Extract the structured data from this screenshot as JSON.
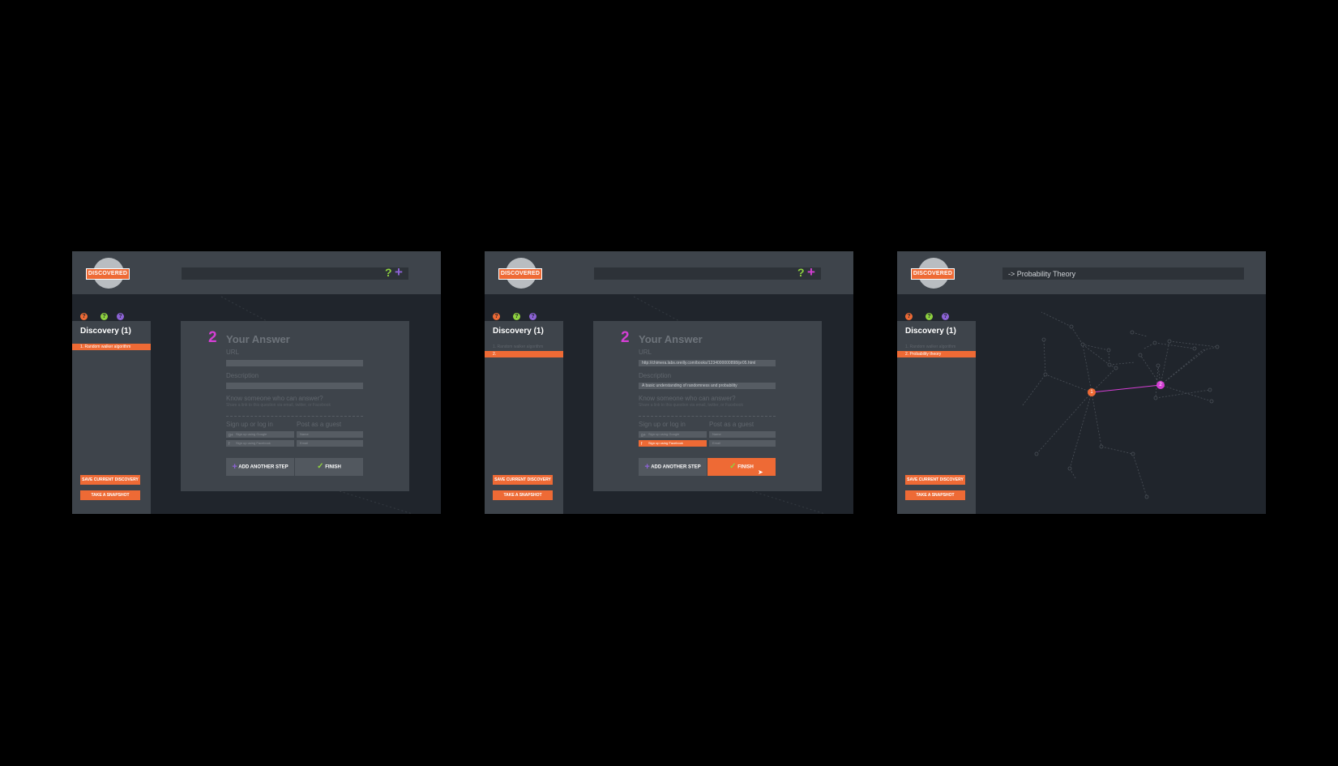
{
  "colors": {
    "background": "#000000",
    "canvas": "#20252c",
    "chrome": "#3e444b",
    "accent": "#ee6a35",
    "help_green": "#8ed13f",
    "add_purple": "#8d63d6",
    "step_magenta": "#d43fd4",
    "tab_orange": "#ee6a35",
    "tab_green": "#8ed13f",
    "tab_purple": "#8d63d6"
  },
  "icons": {
    "logo": "discovered-badge",
    "help": "question-mark-icon",
    "add": "plus-icon",
    "google": "google-icon",
    "facebook": "facebook-icon",
    "check": "check-icon",
    "cursor": "mouse-pointer-icon"
  },
  "screens": [
    {
      "logo_text": "DISCOVERED",
      "search": {
        "help": "?",
        "add": "+",
        "breadcrumb": ""
      },
      "tabs": [
        "?",
        "?",
        "?"
      ],
      "sidebar": {
        "title": "Discovery (1)",
        "items": [
          {
            "label": "1. Random walker algorithm",
            "active": true
          }
        ],
        "save_label": "SAVE CURRENT DISCOVERY",
        "snapshot_label": "TAKE A SNAPSHOT"
      },
      "panel": {
        "step_number": "2",
        "title": "Your Answer",
        "url_label": "URL",
        "url_value": "",
        "description_label": "Description",
        "description_value": "",
        "know_label": "Know someone who can answer?",
        "know_sub": "Share a link to this question via email, twitter, or Facebook",
        "signup_label": "Sign up or log in",
        "guest_label": "Post as a guest",
        "google_label": "Sign up using Google",
        "facebook_label": "Sign up using Facebook",
        "name_placeholder": "Name",
        "email_placeholder": "Email",
        "add_step_label": "ADD ANOTHER STEP",
        "finish_label": "FINISH",
        "facebook_highlighted": false,
        "finish_highlighted": false
      }
    },
    {
      "logo_text": "DISCOVERED",
      "search": {
        "help": "?",
        "add": "+",
        "breadcrumb": ""
      },
      "tabs": [
        "?",
        "?",
        "?"
      ],
      "sidebar": {
        "title": "Discovery (1)",
        "items": [
          {
            "label": "1. Random walker algorithm",
            "active": false
          },
          {
            "label": "2.",
            "active": true
          }
        ],
        "save_label": "SAVE CURRENT DISCOVERY",
        "snapshot_label": "TAKE A SNAPSHOT"
      },
      "panel": {
        "step_number": "2",
        "title": "Your Answer",
        "url_label": "URL",
        "url_value": "http://chimera.labs.oreilly.com/books/1234000000898/pr05.html",
        "description_label": "Description",
        "description_value": "A basic understanding of randomness and probability",
        "know_label": "Know someone who can answer?",
        "know_sub": "Share a link to this question via email, twitter, or Facebook",
        "signup_label": "Sign up or log in",
        "guest_label": "Post as a guest",
        "google_label": "Sign up using Google",
        "facebook_label": "Sign up using Facebook",
        "name_placeholder": "Name",
        "email_placeholder": "Email",
        "add_step_label": "ADD ANOTHER STEP",
        "finish_label": "FINISH",
        "facebook_highlighted": true,
        "finish_highlighted": true
      }
    },
    {
      "logo_text": "DISCOVERED",
      "search": {
        "help": "",
        "add": "",
        "breadcrumb": "-> Probability Theory"
      },
      "tabs": [
        "?",
        "?",
        "?"
      ],
      "sidebar": {
        "title": "Discovery (1)",
        "items": [
          {
            "label": "1. Random walker algorithm",
            "active": false
          },
          {
            "label": "2. Probability theory",
            "active": true
          }
        ],
        "save_label": "SAVE CURRENT DISCOVERY",
        "snapshot_label": "TAKE A SNAPSHOT"
      },
      "graph": {
        "highlight_nodes": [
          {
            "label": "1",
            "color": "#ee6a35"
          },
          {
            "label": "2",
            "color": "#d43fd4"
          }
        ]
      }
    }
  ]
}
